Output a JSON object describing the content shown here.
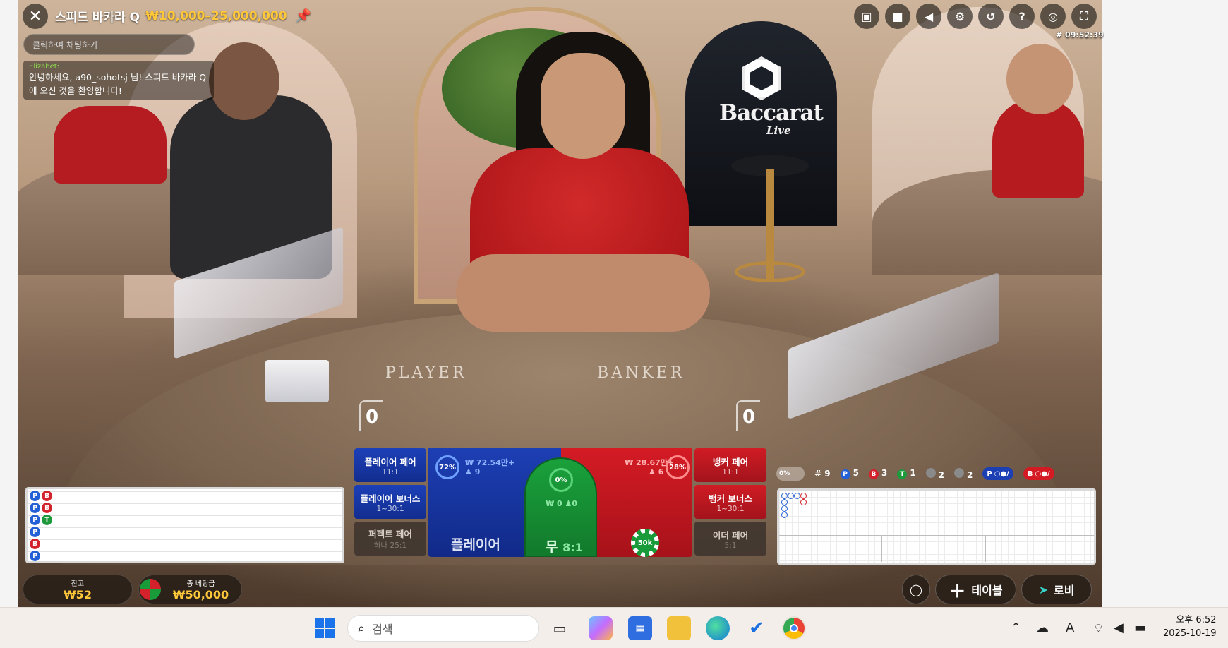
{
  "header": {
    "title": "스피드 바카라 Q",
    "limit": "₩10,000–25,000,000",
    "game_id": "# 09:52:39"
  },
  "chat": {
    "placeholder": "클릭하여 채팅하기",
    "message_user": "Elizabet:",
    "message_text": "안녕하세요, a90_sohotsj 님! 스피드 바카라 Q에 오신 것을 환영합니다!"
  },
  "table_scene": {
    "player_word": "PLAYER",
    "banker_word": "BANKER",
    "brand_name": "Baccarat",
    "brand_sub": "Live"
  },
  "scores": {
    "player": "0",
    "banker": "0"
  },
  "bets": {
    "player_pair": {
      "label": "플레이어 페어",
      "odds": "11:1"
    },
    "player_bonus": {
      "label": "플레이어 보너스",
      "odds": "1~30:1"
    },
    "perfect_pair": {
      "label": "퍼펙트 페어",
      "odds": "하나 25:1"
    },
    "banker_pair": {
      "label": "뱅커 페어",
      "odds": "11:1"
    },
    "banker_bonus": {
      "label": "뱅커 보너스",
      "odds": "1~30:1"
    },
    "either_pair": {
      "label": "이더 페어",
      "odds": "5:1"
    },
    "player": {
      "label": "플레이어",
      "percent": "72%",
      "amount": "₩ 72.54만+",
      "count": "9"
    },
    "tie": {
      "label": "무",
      "odds": "8:1",
      "percent": "0%",
      "amount": "₩ 0",
      "count": "0"
    },
    "banker": {
      "percent": "28%",
      "amount": "₩ 28.67만+",
      "count": "6"
    },
    "chip_value": "50k"
  },
  "road_stats": {
    "toggle": "0%",
    "rounds": "# 9",
    "player_count": "5",
    "banker_count": "3",
    "tie_count": "1",
    "player_pair_count": "2",
    "banker_pair_count": "2",
    "player_pred": "P",
    "banker_pred": "B"
  },
  "bead_road": [
    [
      "P",
      "B"
    ],
    [
      "P",
      "B"
    ],
    [
      "P",
      "T"
    ],
    [
      "P",
      ""
    ],
    [
      "B",
      ""
    ],
    [
      "P",
      ""
    ]
  ],
  "footer": {
    "balance_label": "잔고",
    "balance_value": "₩52",
    "total_bet_label": "총 베팅금",
    "total_bet_value": "₩50,000",
    "table_button": "테이블",
    "lobby_button": "로비"
  },
  "taskbar": {
    "search_placeholder": "검색",
    "time": "오후 6:52",
    "date": "2025-10-19"
  },
  "colors": {
    "player": "#1d3fb4",
    "banker": "#d41b24",
    "tie": "#1aa13b",
    "gold": "#ffc83a"
  }
}
